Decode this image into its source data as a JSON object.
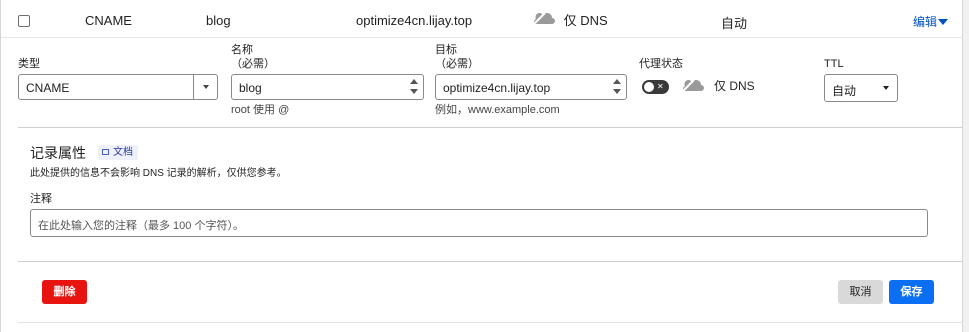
{
  "record": {
    "type": "CNAME",
    "name": "blog",
    "content": "optimize4cn.lijay.top",
    "proxy_label": "仅 DNS",
    "ttl": "自动",
    "edit_label": "编辑"
  },
  "form": {
    "type_label": "类型",
    "type_value": "CNAME",
    "name_label": "名称",
    "name_required": "（必需）",
    "name_value": "blog",
    "name_hint": "root 使用 @",
    "target_label": "目标",
    "target_required": "（必需）",
    "target_value": "optimize4cn.lijay.top",
    "target_hint": "例如，www.example.com",
    "proxy_label": "代理状态",
    "proxy_value": "仅 DNS",
    "proxy_enabled": false,
    "ttl_label": "TTL",
    "ttl_value": "自动"
  },
  "attributes": {
    "title": "记录属性",
    "doc_label": "文档",
    "description": "此处提供的信息不会影响 DNS 记录的解析，仅供您参考。",
    "comment_label": "注释",
    "comment_placeholder": "在此处输入您的注释（最多 100 个字符）。"
  },
  "buttons": {
    "delete": "删除",
    "cancel": "取消",
    "save": "保存"
  },
  "colors": {
    "delete": "#e8140f",
    "save": "#0a6ff2",
    "link": "#0051c3",
    "cloud_grey": "#9a9a9a"
  }
}
